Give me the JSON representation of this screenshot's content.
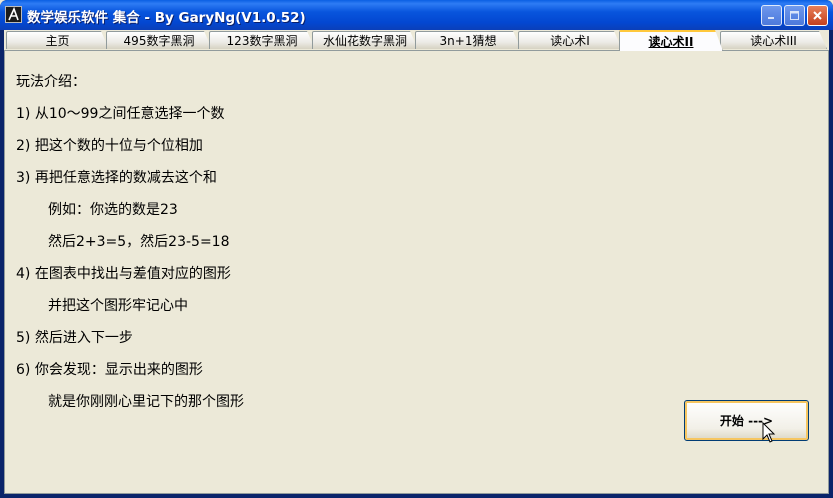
{
  "window": {
    "title": "数学娱乐软件 集合 - By GaryNg(V1.0.52)"
  },
  "tabs": [
    {
      "label": "主页"
    },
    {
      "label": "495数字黑洞"
    },
    {
      "label": "123数字黑洞"
    },
    {
      "label": "水仙花数字黑洞"
    },
    {
      "label": "3n+1猜想"
    },
    {
      "label": "读心术I"
    },
    {
      "label": "读心术II",
      "active": true
    },
    {
      "label": "读心术III"
    }
  ],
  "content": {
    "heading": "玩法介绍：",
    "lines": [
      "1) 从10～99之间任意选择一个数",
      "2) 把这个数的十位与个位相加",
      "3) 再把任意选择的数减去这个和",
      "例如：你选的数是23",
      "然后2+3=5，然后23-5=18",
      "4) 在图表中找出与差值对应的图形",
      "并把这个图形牢记心中",
      "5) 然后进入下一步",
      "6) 你会发现：显示出来的图形",
      "就是你刚刚心里记下的那个图形"
    ]
  },
  "start_button": {
    "label": "开始 --->"
  },
  "icons": {
    "app": "app-icon",
    "minimize": "minimize-icon",
    "maximize": "maximize-icon",
    "close": "close-icon",
    "cursor": "mouse-cursor-icon"
  }
}
